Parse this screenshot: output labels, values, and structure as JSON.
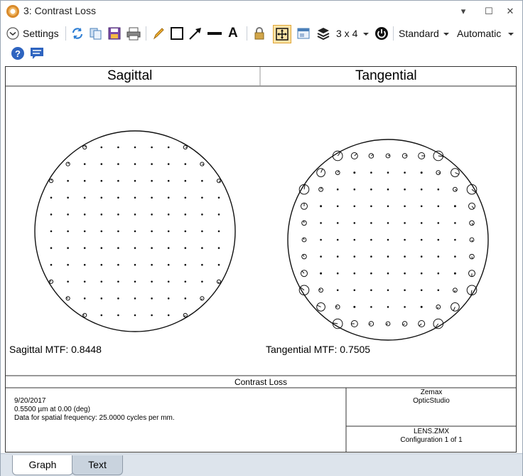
{
  "window": {
    "title": "3: Contrast Loss",
    "controls": {
      "dropdown": "▾",
      "maximize": "☐",
      "close": "✕"
    }
  },
  "toolbar": {
    "settings_label": "Settings",
    "text_tool_label": "A",
    "layout_label": "3 x 4",
    "standard_label": "Standard",
    "automatic_label": "Automatic",
    "icons": [
      "settings-chevron-icon",
      "refresh-icon",
      "copy-icon",
      "save-icon",
      "print-icon",
      "pencil-icon",
      "rectangle-icon",
      "arrow-icon",
      "line-icon",
      "text-icon",
      "lock-icon",
      "fit-icon",
      "window-icon",
      "layers-icon",
      "layout-dropdown-icon",
      "power-icon",
      "standard-dropdown-icon",
      "automatic-dropdown-icon",
      "help-icon",
      "comment-icon"
    ]
  },
  "graph": {
    "sagittal_title": "Sagittal",
    "tangential_title": "Tangential",
    "sagittal_mtf": "Sagittal MTF: 0.8448",
    "tangential_mtf": "Tangential MTF: 0.7505",
    "caption_title": "Contrast Loss",
    "info_date": "9/20/2017",
    "info_wavelength": "0.5500 µm at 0.00 (deg)",
    "info_frequency": "Data for spatial frequency: 25.0000 cycles per mm.",
    "vendor": "Zemax",
    "product": "OpticStudio",
    "filename": "LENS.ZMX",
    "configuration": "Configuration 1 of 1"
  },
  "tabs": [
    {
      "label": "Graph",
      "active": true
    },
    {
      "label": "Text",
      "active": false
    }
  ]
}
